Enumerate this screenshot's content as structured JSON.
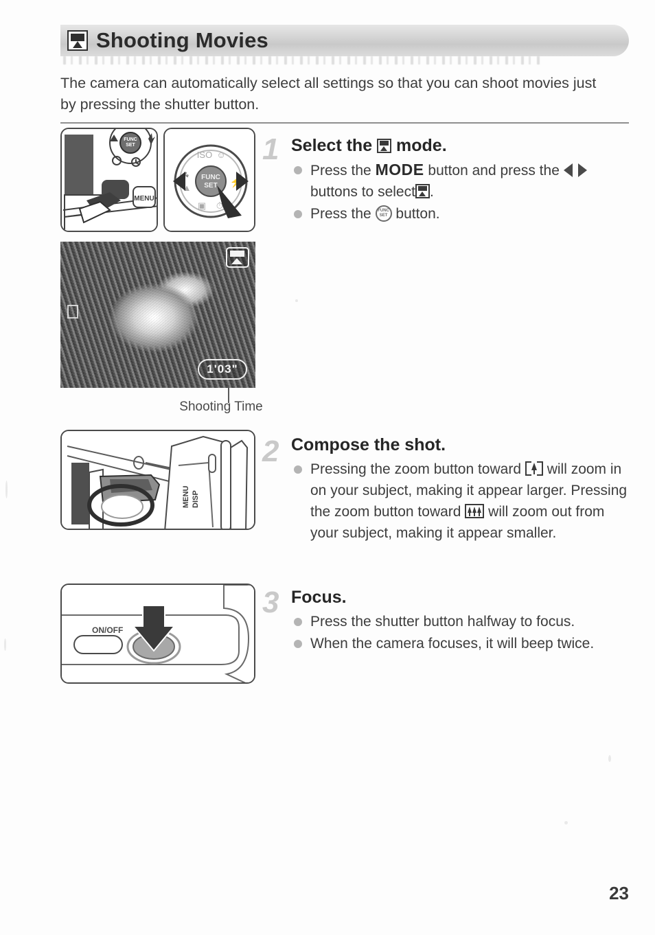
{
  "header": {
    "icon": "movie-camera-icon",
    "title": "Shooting Movies"
  },
  "intro": "The camera can automatically select all settings so that you can shoot movies just by pressing the shutter button.",
  "steps": [
    {
      "number": "1",
      "heading_before": "Select the",
      "heading_icon": "movie-mode-icon",
      "heading_after": "mode.",
      "bullets": [
        {
          "part1": "Press the",
          "mode_word": "MODE",
          "part2": "button and press the",
          "arrows_icon": "left-right-arrows-icon",
          "part3": "buttons to select",
          "movie_icon": "movie-mode-icon",
          "part4": "."
        },
        {
          "part1": "Press the",
          "funcset_icon": "func-set-button-icon",
          "funcset_label_top": "FUNC",
          "funcset_label_bottom": "SET",
          "part2": "button."
        }
      ],
      "figures": [
        "camera-back-menu-button-diagram",
        "control-dial-func-set-diagram"
      ],
      "screen": {
        "osd_mode_icon": "movie-mode-osd-icon",
        "osd_af_frame": "af-frame-icon",
        "shooting_time": "1'03\"",
        "caption": "Shooting Time"
      }
    },
    {
      "number": "2",
      "heading": "Compose the shot.",
      "bullets": [
        {
          "part1": "Pressing the zoom button toward",
          "tele_icon": "telephoto-zoom-icon",
          "part2": "will zoom in on your subject, making it appear larger. Pressing the zoom button toward",
          "wide_icon": "wide-angle-zoom-icon",
          "part3": "will zoom out from your subject, making it appear smaller."
        }
      ],
      "figure": "camera-zoom-button-diagram"
    },
    {
      "number": "3",
      "heading": "Focus.",
      "bullets": [
        {
          "text": "Press the shutter button halfway to focus."
        },
        {
          "text": "When the camera focuses, it will beep twice."
        }
      ],
      "figure": "camera-shutter-button-diagram",
      "figure_labels": {
        "power": "ON/OFF"
      }
    }
  ],
  "page_number": "23"
}
